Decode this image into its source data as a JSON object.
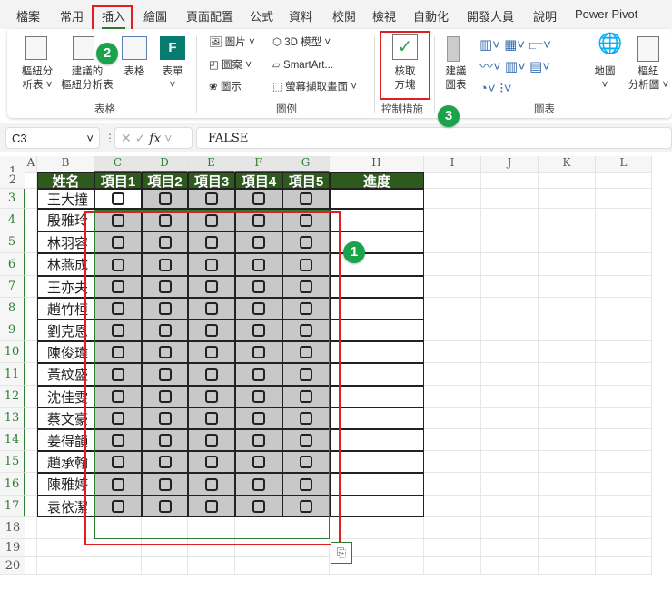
{
  "menu": [
    "檔案",
    "常用",
    "插入",
    "繪圖",
    "頁面配置",
    "公式",
    "資料",
    "校閱",
    "檢視",
    "自動化",
    "開發人員",
    "說明",
    "Power Pivot"
  ],
  "ribbon": {
    "pivot_table": "樞紐分\n析表 ˅",
    "recommended_pivot": "建議的\n樞紐分析表",
    "table": "表格",
    "forms": "表單\n˅",
    "group_tables": "表格",
    "pictures": "圖片 ˅",
    "shapes": "圖案 ˅",
    "icons": "圖示",
    "model3d": "3D 模型  ˅",
    "smartart": "SmartArt...",
    "screenshot": "螢幕擷取畫面 ˅",
    "group_illustrations": "圖例",
    "checkbox": "核取\n方塊",
    "group_controls": "控制措施",
    "recommended_charts": "建議\n圖表",
    "maps": "地圖\n˅",
    "pivot_chart": "樞紐\n分析圖 ˅",
    "group_charts": "圖表"
  },
  "formula_bar": {
    "name_box": "C3",
    "fx": "fx",
    "value": "FALSE"
  },
  "columns": [
    "A",
    "B",
    "C",
    "D",
    "E",
    "F",
    "G",
    "H",
    "I",
    "J",
    "K",
    "L"
  ],
  "rows": [
    "1",
    "2",
    "3",
    "4",
    "5",
    "6",
    "7",
    "8",
    "9",
    "10",
    "11",
    "12",
    "13",
    "14",
    "15",
    "16",
    "17",
    "18",
    "19",
    "20"
  ],
  "table": {
    "headers": [
      "姓名",
      "項目1",
      "項目2",
      "項目3",
      "項目4",
      "項目5",
      "進度"
    ],
    "names": [
      "王大撞",
      "殷雅玲",
      "林羽容",
      "林燕成",
      "王亦夫",
      "趙竹桓",
      "劉克恩",
      "陳俊瑋",
      "黃紋盛",
      "沈佳雯",
      "蔡文豪",
      "姜得韻",
      "趙承翰",
      "陳雅婷",
      "袁依潔"
    ],
    "checked": false
  },
  "badges": [
    "1",
    "2",
    "3"
  ],
  "colors": {
    "header": "#2e5a1e",
    "accent": "#1aa34a",
    "highlight": "#e02020"
  }
}
